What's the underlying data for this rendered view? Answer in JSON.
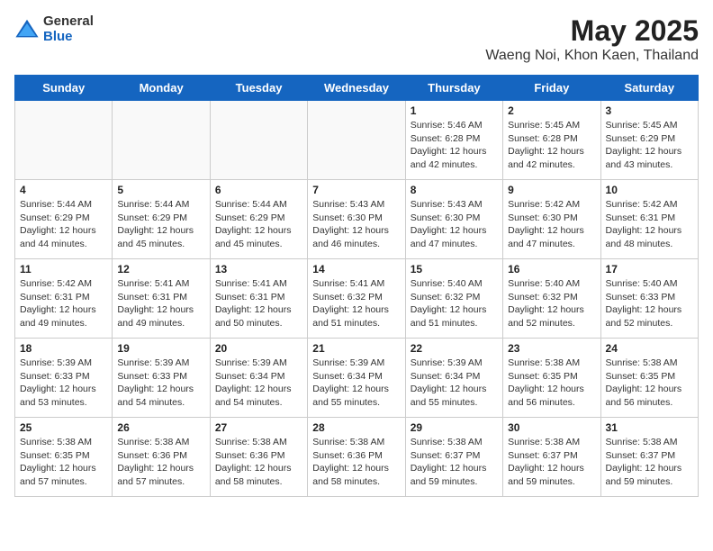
{
  "header": {
    "logo": {
      "general": "General",
      "blue": "Blue"
    },
    "title": "May 2025",
    "subtitle": "Waeng Noi, Khon Kaen, Thailand"
  },
  "calendar": {
    "weekdays": [
      "Sunday",
      "Monday",
      "Tuesday",
      "Wednesday",
      "Thursday",
      "Friday",
      "Saturday"
    ],
    "weeks": [
      [
        {
          "day": "",
          "info": ""
        },
        {
          "day": "",
          "info": ""
        },
        {
          "day": "",
          "info": ""
        },
        {
          "day": "",
          "info": ""
        },
        {
          "day": "1",
          "info": "Sunrise: 5:46 AM\nSunset: 6:28 PM\nDaylight: 12 hours and 42 minutes."
        },
        {
          "day": "2",
          "info": "Sunrise: 5:45 AM\nSunset: 6:28 PM\nDaylight: 12 hours and 42 minutes."
        },
        {
          "day": "3",
          "info": "Sunrise: 5:45 AM\nSunset: 6:29 PM\nDaylight: 12 hours and 43 minutes."
        }
      ],
      [
        {
          "day": "4",
          "info": "Sunrise: 5:44 AM\nSunset: 6:29 PM\nDaylight: 12 hours and 44 minutes."
        },
        {
          "day": "5",
          "info": "Sunrise: 5:44 AM\nSunset: 6:29 PM\nDaylight: 12 hours and 45 minutes."
        },
        {
          "day": "6",
          "info": "Sunrise: 5:44 AM\nSunset: 6:29 PM\nDaylight: 12 hours and 45 minutes."
        },
        {
          "day": "7",
          "info": "Sunrise: 5:43 AM\nSunset: 6:30 PM\nDaylight: 12 hours and 46 minutes."
        },
        {
          "day": "8",
          "info": "Sunrise: 5:43 AM\nSunset: 6:30 PM\nDaylight: 12 hours and 47 minutes."
        },
        {
          "day": "9",
          "info": "Sunrise: 5:42 AM\nSunset: 6:30 PM\nDaylight: 12 hours and 47 minutes."
        },
        {
          "day": "10",
          "info": "Sunrise: 5:42 AM\nSunset: 6:31 PM\nDaylight: 12 hours and 48 minutes."
        }
      ],
      [
        {
          "day": "11",
          "info": "Sunrise: 5:42 AM\nSunset: 6:31 PM\nDaylight: 12 hours and 49 minutes."
        },
        {
          "day": "12",
          "info": "Sunrise: 5:41 AM\nSunset: 6:31 PM\nDaylight: 12 hours and 49 minutes."
        },
        {
          "day": "13",
          "info": "Sunrise: 5:41 AM\nSunset: 6:31 PM\nDaylight: 12 hours and 50 minutes."
        },
        {
          "day": "14",
          "info": "Sunrise: 5:41 AM\nSunset: 6:32 PM\nDaylight: 12 hours and 51 minutes."
        },
        {
          "day": "15",
          "info": "Sunrise: 5:40 AM\nSunset: 6:32 PM\nDaylight: 12 hours and 51 minutes."
        },
        {
          "day": "16",
          "info": "Sunrise: 5:40 AM\nSunset: 6:32 PM\nDaylight: 12 hours and 52 minutes."
        },
        {
          "day": "17",
          "info": "Sunrise: 5:40 AM\nSunset: 6:33 PM\nDaylight: 12 hours and 52 minutes."
        }
      ],
      [
        {
          "day": "18",
          "info": "Sunrise: 5:39 AM\nSunset: 6:33 PM\nDaylight: 12 hours and 53 minutes."
        },
        {
          "day": "19",
          "info": "Sunrise: 5:39 AM\nSunset: 6:33 PM\nDaylight: 12 hours and 54 minutes."
        },
        {
          "day": "20",
          "info": "Sunrise: 5:39 AM\nSunset: 6:34 PM\nDaylight: 12 hours and 54 minutes."
        },
        {
          "day": "21",
          "info": "Sunrise: 5:39 AM\nSunset: 6:34 PM\nDaylight: 12 hours and 55 minutes."
        },
        {
          "day": "22",
          "info": "Sunrise: 5:39 AM\nSunset: 6:34 PM\nDaylight: 12 hours and 55 minutes."
        },
        {
          "day": "23",
          "info": "Sunrise: 5:38 AM\nSunset: 6:35 PM\nDaylight: 12 hours and 56 minutes."
        },
        {
          "day": "24",
          "info": "Sunrise: 5:38 AM\nSunset: 6:35 PM\nDaylight: 12 hours and 56 minutes."
        }
      ],
      [
        {
          "day": "25",
          "info": "Sunrise: 5:38 AM\nSunset: 6:35 PM\nDaylight: 12 hours and 57 minutes."
        },
        {
          "day": "26",
          "info": "Sunrise: 5:38 AM\nSunset: 6:36 PM\nDaylight: 12 hours and 57 minutes."
        },
        {
          "day": "27",
          "info": "Sunrise: 5:38 AM\nSunset: 6:36 PM\nDaylight: 12 hours and 58 minutes."
        },
        {
          "day": "28",
          "info": "Sunrise: 5:38 AM\nSunset: 6:36 PM\nDaylight: 12 hours and 58 minutes."
        },
        {
          "day": "29",
          "info": "Sunrise: 5:38 AM\nSunset: 6:37 PM\nDaylight: 12 hours and 59 minutes."
        },
        {
          "day": "30",
          "info": "Sunrise: 5:38 AM\nSunset: 6:37 PM\nDaylight: 12 hours and 59 minutes."
        },
        {
          "day": "31",
          "info": "Sunrise: 5:38 AM\nSunset: 6:37 PM\nDaylight: 12 hours and 59 minutes."
        }
      ]
    ]
  }
}
